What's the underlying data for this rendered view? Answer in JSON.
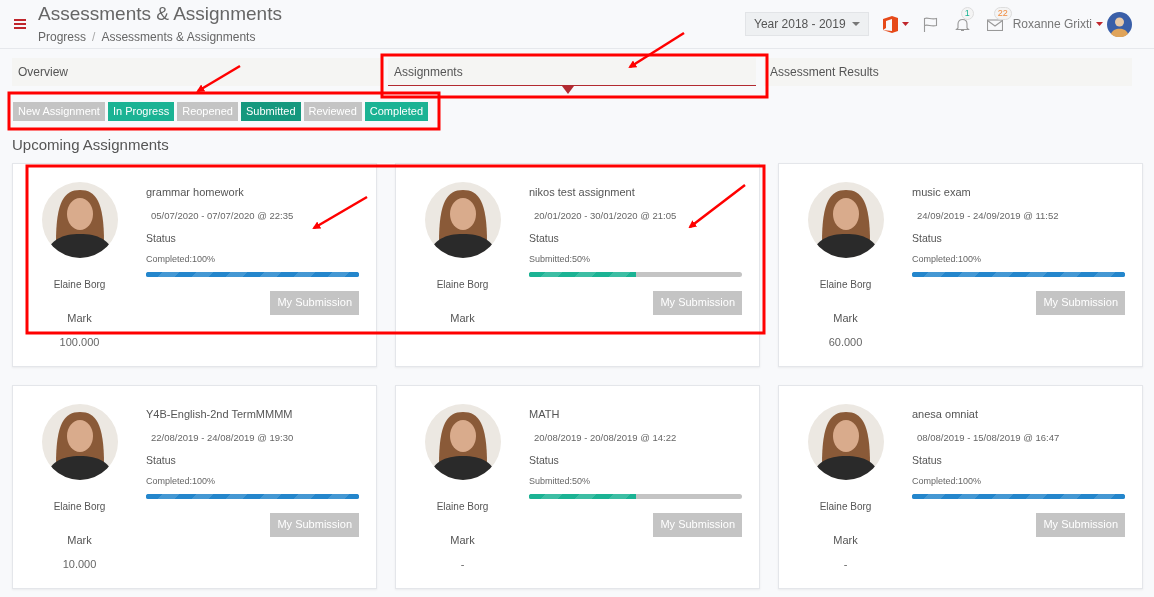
{
  "header": {
    "title": "Assessments & Assignments",
    "breadcrumb": [
      "Progress",
      "Assessments & Assignments"
    ],
    "breadcrumb_separator": "/",
    "year_selector": "Year 2018 - 2019",
    "notifications_count": "1",
    "messages_count": "22",
    "user_name": "Roxanne Grixti"
  },
  "tabs": [
    {
      "label": "Overview",
      "selected": false
    },
    {
      "label": "Assignments",
      "selected": true
    },
    {
      "label": "Assessment Results",
      "selected": false
    }
  ],
  "legend": [
    {
      "label": "New Assignment",
      "color": "#c4c4c4"
    },
    {
      "label": "In Progress",
      "color": "#1bb394"
    },
    {
      "label": "Reopened",
      "color": "#c4c4c4"
    },
    {
      "label": "Submitted",
      "color": "#16987e"
    },
    {
      "label": "Reviewed",
      "color": "#c4c4c4"
    },
    {
      "label": "Completed",
      "color": "#1bb394"
    }
  ],
  "section_title": "Upcoming Assignments",
  "assignments": [
    {
      "title": "grammar homework",
      "dates": "05/07/2020 - 07/07/2020 @ 22:35",
      "status_label": "Status",
      "status": {
        "kind": "completed",
        "text": "Completed:100%",
        "level": 1
      },
      "teacher": "Elaine Borg",
      "mark_label": "Mark",
      "mark": "100.000",
      "button": "My Submission"
    },
    {
      "title": "nikos test assignment",
      "dates": "20/01/2020 - 30/01/2020 @ 21:05",
      "status_label": "Status",
      "status": {
        "kind": "submitted",
        "text": "Submitted:50%",
        "level": 0.5
      },
      "teacher": "Elaine Borg",
      "mark_label": "Mark",
      "button": "My Submission"
    },
    {
      "title": "music exam",
      "dates": "24/09/2019 - 24/09/2019 @ 11:52",
      "status_label": "Status",
      "status": {
        "kind": "completed",
        "text": "Completed:100%",
        "level": 1
      },
      "teacher": "Elaine Borg",
      "mark_label": "Mark",
      "mark": "60.000",
      "button": "My Submission"
    },
    {
      "title": "Y4B-English-2nd TermMMMM",
      "dates": "22/08/2019 - 24/08/2019 @ 19:30",
      "status_label": "Status",
      "status": {
        "kind": "completed",
        "text": "Completed:100%",
        "level": 1
      },
      "teacher": "Elaine Borg",
      "mark_label": "Mark",
      "mark": "10.000",
      "button": "My Submission"
    },
    {
      "title": "MATH",
      "dates": "20/08/2019 - 20/08/2019 @ 14:22",
      "status_label": "Status",
      "status": {
        "kind": "submitted",
        "text": "Submitted:50%",
        "level": 0.5
      },
      "teacher": "Elaine Borg",
      "mark_label": "Mark",
      "mark": "-",
      "button": "My Submission"
    },
    {
      "title": "anesa omniat",
      "dates": "08/08/2019 - 15/08/2019 @ 16:47",
      "status_label": "Status",
      "status": {
        "kind": "completed",
        "text": "Completed:100%",
        "level": 1
      },
      "teacher": "Elaine Borg",
      "mark_label": "Mark",
      "mark": "-",
      "button": "My Submission"
    }
  ]
}
